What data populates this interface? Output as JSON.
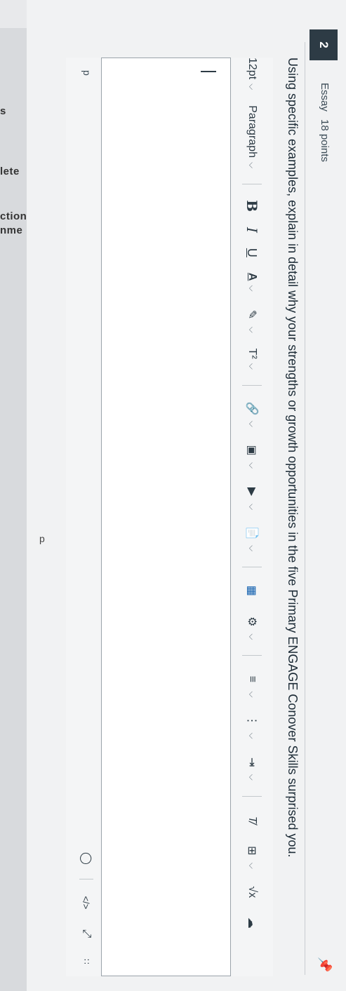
{
  "sidebar": {
    "fragments": [
      "s",
      "lete",
      "ction",
      "nme"
    ],
    "paragraph_label": "p"
  },
  "question": {
    "number": "2",
    "type": "Essay",
    "points": "18 points",
    "prompt": "Using specific examples, explain in detail why your strengths or growth opportunities in the five Primary ENGAGE Conover Skills surprised you."
  },
  "toolbar": {
    "font_size": "12pt",
    "block_format": "Paragraph",
    "bold": "B",
    "italic": "I",
    "underline": "U",
    "text_color": "A",
    "superscript": "T²"
  },
  "icons": [
    "link-icon",
    "image-icon",
    "media-icon",
    "document-icon",
    "apps-icon",
    "plugin-icon",
    "align-icon",
    "ordered-list-icon",
    "indent-icon",
    "clear-format-icon",
    "table-icon",
    "equation-icon",
    "more-icon"
  ],
  "statusbar": {
    "element_path": "p",
    "accessibility_icon": "accessibility-icon",
    "html_view": "</>"
  },
  "colors": {
    "accent": "#2d3b45",
    "background": "#f1f2f3"
  }
}
